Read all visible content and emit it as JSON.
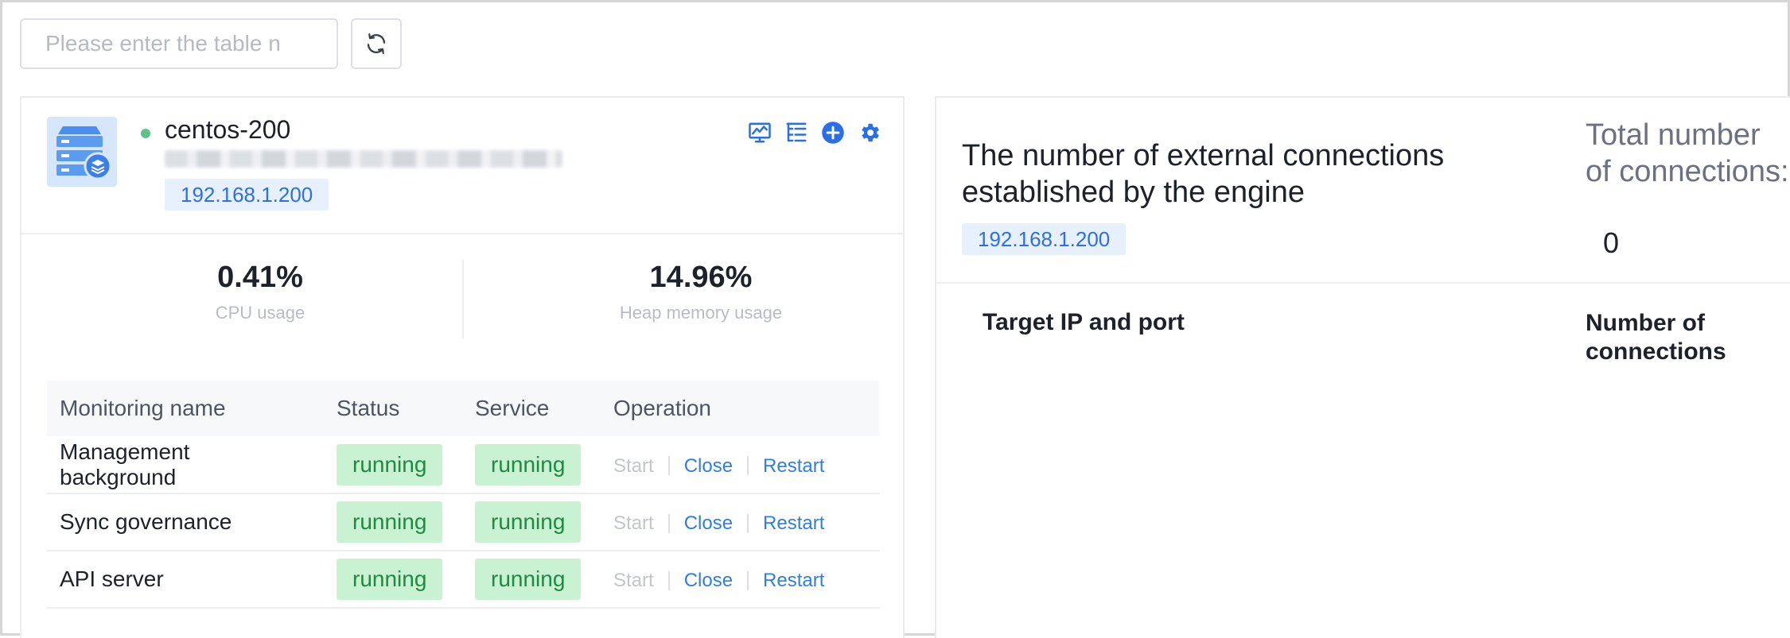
{
  "toolbar": {
    "search_placeholder": "Please enter the table n"
  },
  "engine_card": {
    "name": "centos-200",
    "status_color": "#5cc48a",
    "ip": "192.168.1.200",
    "actions": [
      "monitor-chart-icon",
      "tree-list-icon",
      "add-circle-icon",
      "gear-icon"
    ],
    "metrics": {
      "cpu": {
        "value": "0.41%",
        "label": "CPU usage"
      },
      "heap": {
        "value": "14.96%",
        "label": "Heap memory usage"
      }
    },
    "table": {
      "headers": [
        "Monitoring name",
        "Status",
        "Service",
        "Operation"
      ],
      "rows": [
        {
          "name": "Management background",
          "status": "running",
          "service": "running",
          "start": "Start",
          "close": "Close",
          "restart": "Restart"
        },
        {
          "name": "Sync governance",
          "status": "running",
          "service": "running",
          "start": "Start",
          "close": "Close",
          "restart": "Restart"
        },
        {
          "name": "API server",
          "status": "running",
          "service": "running",
          "start": "Start",
          "close": "Close",
          "restart": "Restart"
        }
      ]
    }
  },
  "connections_card": {
    "title": "The number of external connections established by the engine",
    "ip": "192.168.1.200",
    "total_label": "Total number of connections:",
    "total_value": "0",
    "columns": [
      "Target IP and port",
      "Number of connections"
    ]
  },
  "colors": {
    "accent": "#2f6fe6",
    "badge_bg": "#c8f2d2",
    "badge_text": "#1e8a43"
  }
}
